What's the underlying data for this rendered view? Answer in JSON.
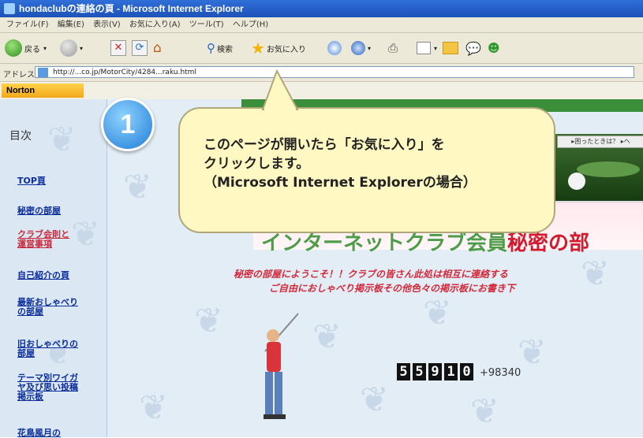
{
  "window": {
    "title": "hondaclubの連絡の頁 - Microsoft Internet Explorer"
  },
  "menu": [
    "ファイル(F)",
    "編集(E)",
    "表示(V)",
    "お気に入り(A)",
    "ツール(T)",
    "ヘルプ(H)"
  ],
  "toolbar": {
    "back_label": "戻る",
    "search_label": "検索",
    "favorites_label": "お気に入り"
  },
  "address": {
    "label": "アドレス(D)",
    "url": "http://...co.jp/MotorCity/4284...raku.html"
  },
  "norton": {
    "label": "Norton"
  },
  "sidebar": {
    "heading": "目次",
    "links": [
      "TOP頁",
      "秘密の部屋",
      "クラブ会則と運営事項",
      "自己紹介の頁",
      "最新おしゃべりの部屋",
      "旧おしゃべりの部屋",
      "テーマ別ワイガヤ及び思い投稿掲示板",
      "花鳥風月の"
    ]
  },
  "content": {
    "nav_button": "▸困ったときは？ ▸ヘ",
    "title_part1": "インターネットクラブ会員",
    "title_part2": "秘密の部",
    "welcome_line1": "秘密の部屋にようこそ！！クラブの皆さん此処は相互に連絡する",
    "welcome_line2": "ご自由におしゃべり掲示板その他色々の掲示板にお書き下",
    "counter_digits": [
      "5",
      "5",
      "9",
      "1",
      "0"
    ],
    "counter_extra": "+98340"
  },
  "callout": {
    "step_number": "1",
    "line1": "このページが開いたら「お気に入り」を",
    "line2": "クリックします。",
    "line3": "（Microsoft Internet Explorerの場合）"
  },
  "colors": {
    "callout_bg": "#fff8c2",
    "title_green": "#4c9c48",
    "title_red": "#d21b2e",
    "link": "#0b2c9b"
  }
}
